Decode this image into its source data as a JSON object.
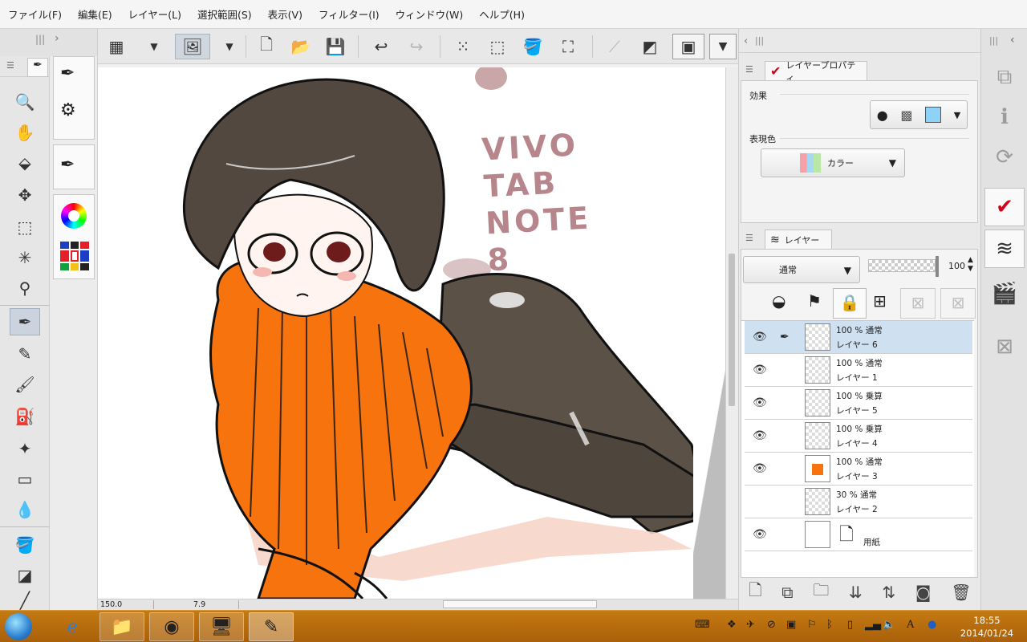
{
  "menu": [
    "ファイル(F)",
    "編集(E)",
    "レイヤー(L)",
    "選択範囲(S)",
    "表示(V)",
    "フィルター(I)",
    "ウィンドウ(W)",
    "ヘルプ(H)"
  ],
  "command_icons": [
    "grid-layout-icon",
    "dropdown-arrow-icon",
    "navigator-icon",
    "dropdown-arrow-icon",
    "new-file-icon",
    "open-folder-icon",
    "save-icon",
    "undo-icon",
    "redo-icon",
    "dots-icon",
    "selection-icon",
    "fill-icon",
    "transform-icon",
    "ruler-off-icon",
    "ruler-icon",
    "canvas-frame-icon",
    "more-dropdown-icon"
  ],
  "tools": [
    "zoom-icon",
    "hand-icon",
    "rotate-icon",
    "move-icon",
    "marquee-icon",
    "magic-wand-icon",
    "eyedropper-icon",
    "pen-icon",
    "pencil-icon",
    "brush-icon",
    "airbrush-icon",
    "decoration-icon",
    "eraser-icon",
    "blend-icon",
    "fill-icon",
    "gradient-icon"
  ],
  "canvas_text": "VIVO TAB NOTE 8",
  "status": {
    "zoom": "150.0",
    "angle": "7.9"
  },
  "layer_property": {
    "tab": "レイヤープロパティ",
    "effect_label": "効果",
    "color_label": "表現色",
    "color_value": "カラー"
  },
  "layers_panel": {
    "tab": "レイヤー",
    "blend_mode": "通常",
    "opacity": "100",
    "rows": [
      {
        "mode": "100 % 通常",
        "name": "レイヤー 6",
        "visible": true,
        "selected": true
      },
      {
        "mode": "100 % 通常",
        "name": "レイヤー 1",
        "visible": true,
        "selected": false
      },
      {
        "mode": "100 % 乗算",
        "name": "レイヤー 5",
        "visible": true,
        "selected": false
      },
      {
        "mode": "100 % 乗算",
        "name": "レイヤー 4",
        "visible": true,
        "selected": false
      },
      {
        "mode": "100 % 通常",
        "name": "レイヤー 3",
        "visible": true,
        "selected": false
      },
      {
        "mode": "30 % 通常",
        "name": "レイヤー 2",
        "visible": false,
        "selected": false
      }
    ],
    "paper_label": "用紙"
  },
  "taskbar": {
    "time": "18:55",
    "date": "2014/01/24",
    "ime": "A"
  }
}
